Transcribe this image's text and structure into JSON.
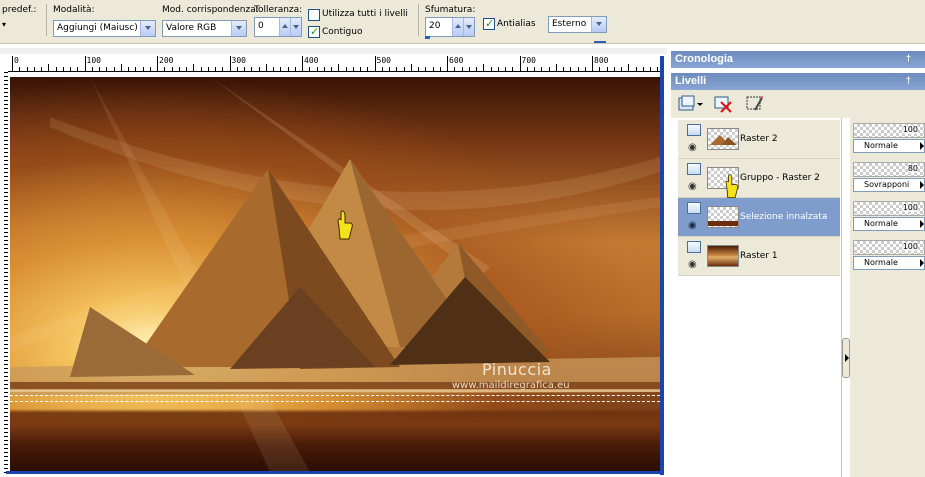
{
  "toolbar": {
    "preset_label": "predef.:",
    "mode": {
      "label": "Modalità:",
      "value": "Aggiungi (Maiusc)"
    },
    "match": {
      "label": "Mod. corrispondenza:",
      "value": "Valore RGB"
    },
    "tolerance": {
      "label": "Tolleranza:",
      "value": "0"
    },
    "use_all_layers": {
      "label": "Utilizza tutti i livelli",
      "checked": false
    },
    "contiguous": {
      "label": "Contiguo",
      "checked": true
    },
    "feather": {
      "label": "Sfumatura:",
      "value": "20"
    },
    "antialias": {
      "label": "Antialias",
      "checked": true
    },
    "antialias_mode": {
      "value": "Esterno"
    }
  },
  "ruler": {
    "labels": [
      "0",
      "100",
      "200",
      "300",
      "400",
      "500",
      "600",
      "700",
      "800"
    ]
  },
  "canvas": {
    "watermark_name": "Pinuccia",
    "watermark_url": "www.maildiregrafica.eu"
  },
  "panels": {
    "history_title": "Cronologia",
    "layers_title": "Livelli"
  },
  "layers": [
    {
      "name": "Raster 2",
      "opacity": "100",
      "blend": "Normale",
      "selected": false
    },
    {
      "name": "Gruppo - Raster 2",
      "opacity": "80",
      "blend": "Sovrapponi",
      "selected": false
    },
    {
      "name": "Selezione innalzata",
      "opacity": "100",
      "blend": "Normale",
      "selected": true
    },
    {
      "name": "Raster 1",
      "opacity": "100",
      "blend": "Normale",
      "selected": false
    }
  ],
  "colors": {
    "panel_title": "#6d8bbd",
    "selection_highlight": "#7f9dcc",
    "window_border": "#1b44b3",
    "toolbar_bg": "#ece9d8"
  }
}
